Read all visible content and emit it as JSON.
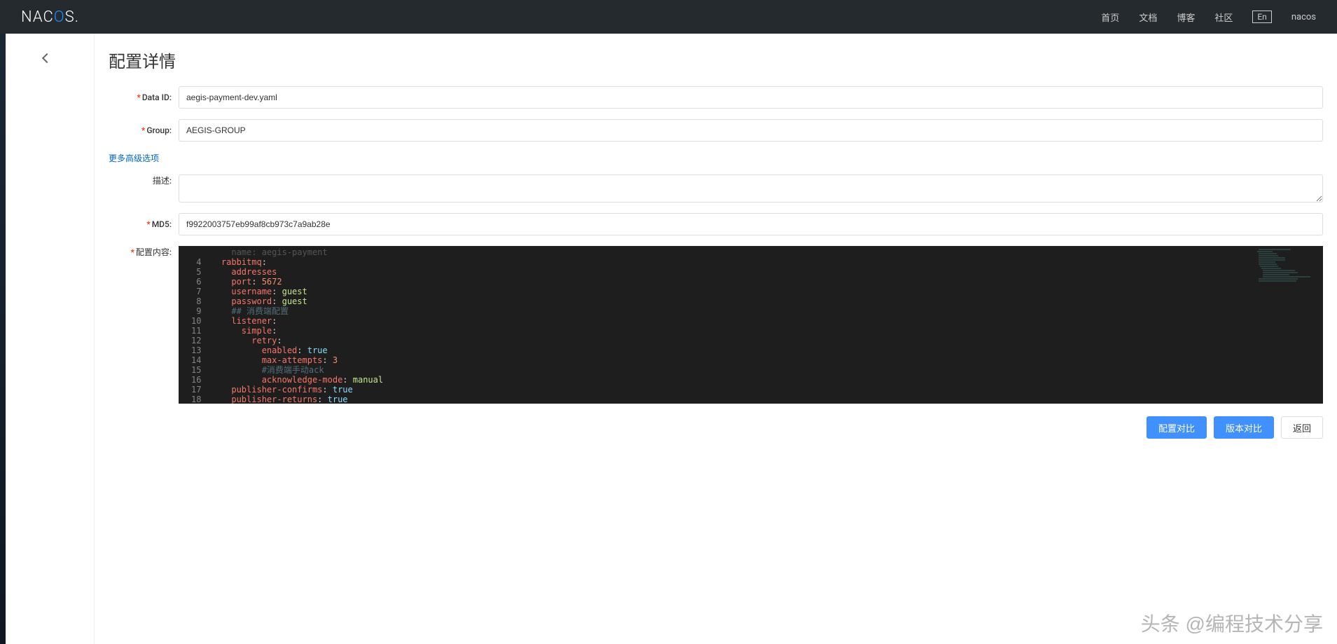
{
  "header": {
    "logo_prefix": "NAC",
    "logo_highlight": "O",
    "logo_suffix": "S.",
    "nav": {
      "home": "首页",
      "docs": "文档",
      "blog": "博客",
      "community": "社区",
      "lang": "En",
      "user": "nacos"
    }
  },
  "page": {
    "title": "配置详情",
    "labels": {
      "data_id": "Data ID:",
      "group": "Group:",
      "advanced": "更多高级选项",
      "description": "描述:",
      "md5": "MD5:",
      "content": "配置内容:"
    },
    "values": {
      "data_id": "aegis-payment-dev.yaml",
      "group": "AEGIS-GROUP",
      "description": "",
      "md5": "f9922003757eb99af8cb973c7a9ab28e"
    }
  },
  "code": {
    "lines": [
      {
        "n": "",
        "tokens": [
          {
            "t": "    name",
            "c": "dim"
          },
          {
            "t": ": ",
            "c": "dim"
          },
          {
            "t": "aegis-payment",
            "c": "dim"
          }
        ]
      },
      {
        "n": "4",
        "tokens": [
          {
            "t": "  rabbitmq",
            "c": "key"
          },
          {
            "t": ":",
            "c": "punct"
          }
        ]
      },
      {
        "n": "5",
        "tokens": [
          {
            "t": "    addresses",
            "c": "key"
          }
        ]
      },
      {
        "n": "6",
        "tokens": [
          {
            "t": "    port",
            "c": "key"
          },
          {
            "t": ": ",
            "c": "punct"
          },
          {
            "t": "5672",
            "c": "num"
          }
        ]
      },
      {
        "n": "7",
        "tokens": [
          {
            "t": "    username",
            "c": "key"
          },
          {
            "t": ": ",
            "c": "punct"
          },
          {
            "t": "guest",
            "c": "str"
          }
        ]
      },
      {
        "n": "8",
        "tokens": [
          {
            "t": "    password",
            "c": "key"
          },
          {
            "t": ": ",
            "c": "punct"
          },
          {
            "t": "guest",
            "c": "str"
          }
        ]
      },
      {
        "n": "9",
        "tokens": [
          {
            "t": "    ## 消费端配置",
            "c": "comment"
          }
        ]
      },
      {
        "n": "10",
        "tokens": [
          {
            "t": "    listener",
            "c": "key"
          },
          {
            "t": ":",
            "c": "punct"
          }
        ]
      },
      {
        "n": "11",
        "tokens": [
          {
            "t": "      simple",
            "c": "key"
          },
          {
            "t": ":",
            "c": "punct"
          }
        ]
      },
      {
        "n": "12",
        "tokens": [
          {
            "t": "        retry",
            "c": "key"
          },
          {
            "t": ":",
            "c": "punct"
          }
        ]
      },
      {
        "n": "13",
        "tokens": [
          {
            "t": "          enabled",
            "c": "key"
          },
          {
            "t": ": ",
            "c": "punct"
          },
          {
            "t": "true",
            "c": "bool"
          }
        ]
      },
      {
        "n": "14",
        "tokens": [
          {
            "t": "          max-attempts",
            "c": "key"
          },
          {
            "t": ": ",
            "c": "punct"
          },
          {
            "t": "3",
            "c": "num"
          }
        ]
      },
      {
        "n": "15",
        "tokens": [
          {
            "t": "          #消费端手动ack",
            "c": "comment"
          }
        ]
      },
      {
        "n": "16",
        "tokens": [
          {
            "t": "          acknowledge-mode",
            "c": "key"
          },
          {
            "t": ": ",
            "c": "punct"
          },
          {
            "t": "manual",
            "c": "str"
          }
        ]
      },
      {
        "n": "17",
        "tokens": [
          {
            "t": "    publisher-confirms",
            "c": "key"
          },
          {
            "t": ": ",
            "c": "punct"
          },
          {
            "t": "true",
            "c": "bool"
          }
        ]
      },
      {
        "n": "18",
        "tokens": [
          {
            "t": "    publisher-returns",
            "c": "key"
          },
          {
            "t": ": ",
            "c": "punct"
          },
          {
            "t": "true",
            "c": "bool"
          }
        ]
      }
    ]
  },
  "buttons": {
    "compare_config": "配置对比",
    "compare_version": "版本对比",
    "back": "返回"
  },
  "watermark": "头条 @编程技术分享"
}
